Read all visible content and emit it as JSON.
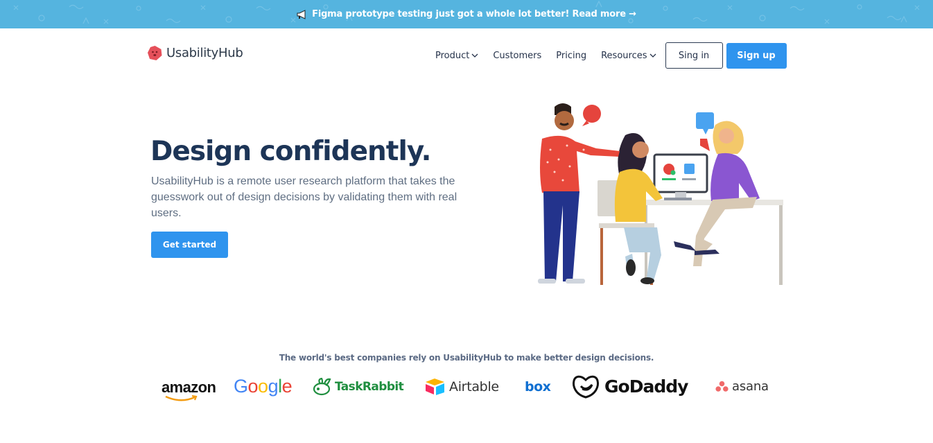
{
  "banner": {
    "text": "Figma prototype testing just got a whole lot better! Read more →",
    "icon": "megaphone-icon",
    "background": "#55b4df"
  },
  "header": {
    "logo_text": "UsabilityHub",
    "logo_icon": "usabilityhub-logo-icon",
    "nav": {
      "product": "Product",
      "customers": "Customers",
      "pricing": "Pricing",
      "resources": "Resources"
    },
    "signin_label": "Sing in",
    "signup_label": "Sign up"
  },
  "hero": {
    "title": "Design confidently.",
    "description": "UsabilityHub is a remote user research platform that takes the guesswork out of design decisions by validating them with real users.",
    "cta_label": "Get started"
  },
  "trust": {
    "title": "The world's best companies rely on UsabilityHub to make better design decisions.",
    "companies": {
      "amazon": "amazon",
      "google": "Google",
      "taskrabbit": "TaskRabbit",
      "airtable": "Airtable",
      "box": "box",
      "godaddy": "GoDaddy",
      "asana": "asana"
    }
  },
  "colors": {
    "primary": "#2f94ee",
    "heading": "#1d3557",
    "text": "#5f6e82"
  }
}
